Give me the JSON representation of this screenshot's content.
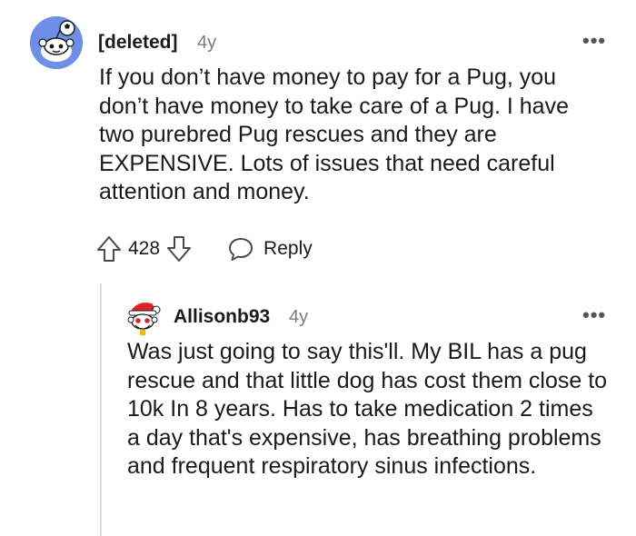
{
  "comments": [
    {
      "username": "[deleted]",
      "age": "4y",
      "more": "•••",
      "body": "If you don’t have money to pay for a Pug, you don’t have money to take care of a Pug. I have two purebred Pug rescues and they are EXPENSIVE. Lots of issues that need careful attention and money.",
      "score": "428",
      "reply_label": "Reply",
      "avatar_icon": "snoo-avatar-icon",
      "avatar_color": "#6d8fe6"
    },
    {
      "username": "Allisonb93",
      "age": "4y",
      "more": "•••",
      "body": "Was just going to say this'll. My BIL has a pug rescue and that little dog has cost them close to 10k In 8 years. Has to take medication 2 times a day that's expensive, has breathing problems and frequent respiratory sinus infections.",
      "avatar_icon": "snoo-santa-avatar-icon",
      "avatar_accent": "#d9242b"
    }
  ]
}
